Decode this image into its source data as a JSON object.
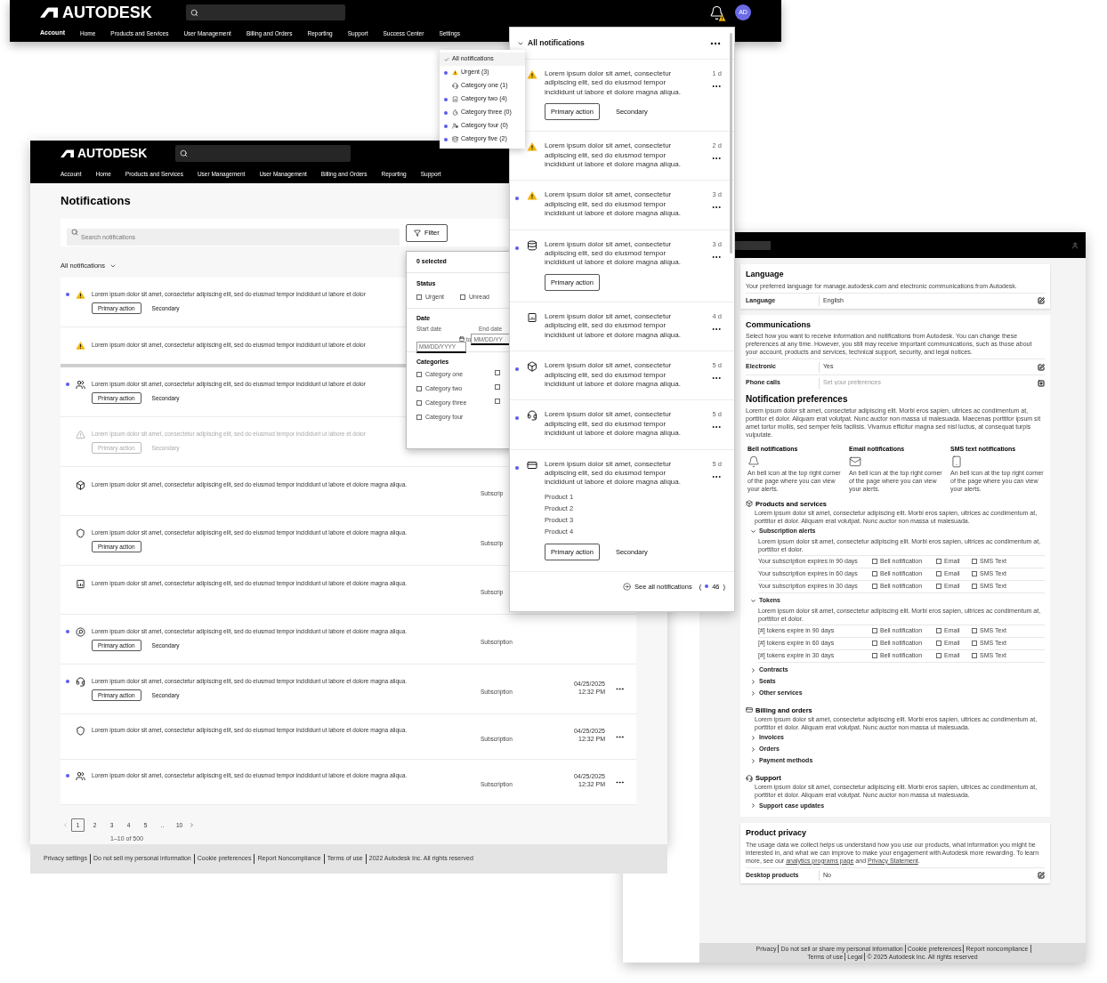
{
  "header_window": {
    "logo": "AUTODESK",
    "nav": [
      {
        "label": "Account",
        "selected": true
      },
      {
        "label": "Home",
        "selected": false
      },
      {
        "label": "Products and Services",
        "selected": false
      },
      {
        "label": "User Management",
        "selected": false
      },
      {
        "label": "Billing and Orders",
        "selected": false
      },
      {
        "label": "Reporting",
        "selected": false
      },
      {
        "label": "Support",
        "selected": false
      },
      {
        "label": "Success Center",
        "selected": false
      },
      {
        "label": "Settings",
        "selected": false
      }
    ],
    "avatar": "AD"
  },
  "filter_menu": {
    "items": [
      {
        "label": "All notifications",
        "kind": "all",
        "selected": true,
        "unread": false
      },
      {
        "label": "Urgent (3)",
        "kind": "warning",
        "selected": false,
        "unread": true
      },
      {
        "label": "Category one (1)",
        "kind": "headset",
        "selected": false,
        "unread": false
      },
      {
        "label": "Category two (4)",
        "kind": "report",
        "selected": false,
        "unread": true
      },
      {
        "label": "Category three (0)",
        "kind": "timer",
        "selected": false,
        "unread": true
      },
      {
        "label": "Category four (0)",
        "kind": "user_gear",
        "selected": false,
        "unread": true
      },
      {
        "label": "Category five (2)",
        "kind": "database",
        "selected": false,
        "unread": true
      }
    ]
  },
  "main_window": {
    "logo": "AUTODESK",
    "nav": [
      "Account",
      "Home",
      "Products and Services",
      "User Management",
      "User Management",
      "Billing and Orders",
      "Reporting",
      "Support"
    ],
    "title": "Notifications",
    "search": {
      "placeholder": "Search notifications"
    },
    "filter_button": "Filter",
    "view_select": "All notifications",
    "rows": [
      {
        "kind": "warning",
        "unread": true,
        "disabled": false,
        "thick_divider": false,
        "text": "Lorem ipsum dolor sit amet, consectetur adipiscing elit, sed do eiusmod tempor incididunt ut labore et dolor",
        "primary_action": "Primary action",
        "secondary_action": "Secondary"
      },
      {
        "kind": "warning",
        "unread": false,
        "disabled": false,
        "thick_divider": true,
        "text": "Lorem ipsum dolor sit amet, consectetur adipiscing elit, sed do eiusmod tempor incididunt ut labore et dolor"
      },
      {
        "kind": "users",
        "unread": true,
        "disabled": false,
        "thick_divider": false,
        "text": "Lorem ipsum dolor sit amet, consectetur adipiscing elit, sed do eiusmod tempor incididunt ut labore et dolor",
        "primary_action": "Primary action",
        "secondary_action": "Secondary"
      },
      {
        "kind": "warning",
        "unread": false,
        "disabled": true,
        "thick_divider": false,
        "text": "Lorem ipsum dolor sit amet, consectetur adipiscing elit, sed do eiusmod tempor incididunt ut labore et dolor",
        "primary_action": "Primary action",
        "secondary_action": "Secondary"
      },
      {
        "kind": "cube",
        "unread": false,
        "disabled": false,
        "thick_divider": false,
        "text": "Lorem ipsum dolor sit amet, consectetur adipiscing elit, sed do eiusmod tempor incididunt ut labore et dolore magna aliqua.",
        "category": "Subscrip"
      },
      {
        "kind": "shield",
        "unread": false,
        "disabled": false,
        "thick_divider": false,
        "text": "Lorem ipsum dolor sit amet, consectetur adipiscing elit, sed do eiusmod tempor incididunt ut labore et dolore magna aliqua.",
        "primary_action": "Primary action",
        "category": "Subscrip"
      },
      {
        "kind": "report",
        "unread": false,
        "disabled": false,
        "thick_divider": false,
        "text": "Lorem ipsum dolor sit amet, consectetur adipiscing elit, sed do eiusmod tempor incididunt ut labore et dolore magna aliqua.",
        "category": "Subscrip"
      },
      {
        "kind": "search",
        "unread": true,
        "disabled": false,
        "thick_divider": false,
        "text": "Lorem ipsum dolor sit amet, consectetur adipiscing elit, sed do eiusmod tempor incididunt ut labore et dolore magna aliqua.",
        "primary_action": "Primary action",
        "secondary_action": "Secondary",
        "category": "Subscription"
      },
      {
        "kind": "headset",
        "unread": true,
        "disabled": false,
        "thick_divider": false,
        "text": "Lorem ipsum dolor sit amet, consectetur adipiscing elit, sed do eiusmod tempor incididunt ut labore et dolore magna aliqua.",
        "primary_action": "Primary action",
        "secondary_action": "Secondary",
        "category": "Subscription",
        "date": "04/25/2025",
        "time": "12:32 PM"
      },
      {
        "kind": "shield",
        "unread": false,
        "disabled": false,
        "thick_divider": false,
        "text": "Lorem ipsum dolor sit amet, consectetur adipiscing elit, sed do eiusmod tempor incididunt ut labore et dolore magna aliqua.",
        "category": "Subscription",
        "date": "04/25/2025",
        "time": "12:32 PM"
      },
      {
        "kind": "users",
        "unread": true,
        "disabled": false,
        "thick_divider": false,
        "text": "Lorem ipsum dolor sit amet, consectetur adipiscing elit, sed do eiusmod tempor incididunt ut labore et dolore magna aliqua.",
        "category": "Subscription",
        "date": "04/25/2025",
        "time": "12:32 PM"
      }
    ],
    "pagination": {
      "pages": [
        {
          "label": "1",
          "selected": true
        },
        {
          "label": "2",
          "selected": false
        },
        {
          "label": "3",
          "selected": false
        },
        {
          "label": "4",
          "selected": false
        },
        {
          "label": "5",
          "selected": false
        },
        {
          "label": "..",
          "selected": false
        },
        {
          "label": "10",
          "selected": false
        }
      ],
      "summary": "1–10 of 500"
    },
    "footer": [
      "Privacy settings",
      "Do not sell my personal information",
      "Cookie preferences",
      "Report Noncompliance",
      "Terms of use",
      "2022 Autodesk Inc. All rights reserved"
    ]
  },
  "filter_popover": {
    "selected_count": "0 selected",
    "status_heading": "Status",
    "status_options": [
      {
        "label": "Urgent",
        "checked": false
      },
      {
        "label": "Unread",
        "checked": false
      }
    ],
    "date_heading": "Date",
    "start_label": "Start date",
    "end_label": "End date",
    "start_placeholder": "MM/DD/YYYY",
    "to": "to",
    "end_placeholder": "MM/DD/YY",
    "categories_heading": "Categories",
    "categories": [
      {
        "label": "Category one",
        "checked": false
      },
      {
        "label": "Category two",
        "checked": false
      },
      {
        "label": "Category three",
        "checked": false
      },
      {
        "label": "Category four",
        "checked": false
      }
    ],
    "categories_col2": [
      {
        "checked": false
      },
      {
        "checked": false
      },
      {
        "checked": false
      }
    ]
  },
  "notification_panel": {
    "title": "All notifications",
    "items": [
      {
        "kind": "warning",
        "unread": false,
        "text": "Lorem ipsum dolor sit amet, consectetur adipiscing elit, sed do eiusmod tempor incididunt ut labore et dolore magna aliqua.",
        "age": "1 d",
        "primary_action": "Primary action",
        "secondary_action": "Secondary"
      },
      {
        "kind": "warning",
        "unread": false,
        "text": "Lorem ipsum dolor sit amet, consectetur adipiscing elit, sed do eiusmod tempor incididunt ut labore et dolore magna aliqua.",
        "age": "2 d"
      },
      {
        "kind": "warning",
        "unread": true,
        "text": "Lorem ipsum dolor sit amet, consectetur adipiscing elit, sed do eiusmod tempor incididunt ut labore et dolore magna aliqua.",
        "age": "3 d"
      },
      {
        "kind": "database",
        "unread": true,
        "text": "Lorem ipsum dolor sit amet, consectetur adipiscing elit, sed do eiusmod tempor incididunt ut labore et dolore magna aliqua.",
        "age": "3 d",
        "primary_action": "Primary action"
      },
      {
        "kind": "report",
        "unread": false,
        "text": "Lorem ipsum dolor sit amet, consectetur adipiscing elit, sed do eiusmod tempor incididunt ut labore et dolore magna aliqua.",
        "age": "4 d"
      },
      {
        "kind": "cube",
        "unread": true,
        "text": "Lorem ipsum dolor sit amet, consectetur adipiscing elit, sed do eiusmod tempor incididunt ut labore et dolore magna aliqua.",
        "age": "5 d"
      },
      {
        "kind": "headset",
        "unread": true,
        "text": "Lorem ipsum dolor sit amet, consectetur adipiscing elit, sed do eiusmod tempor incididunt ut labore et dolore magna aliqua.",
        "age": "5 d"
      },
      {
        "kind": "card",
        "unread": true,
        "text": "Lorem ipsum dolor sit amet, consectetur adipiscing elit, sed do eiusmod tempor incididunt ut labore et dolore magna aliqua.",
        "age": "5 d",
        "products": [
          "Product 1",
          "Product 2",
          "Product 3",
          "Product 4"
        ],
        "primary_action": "Primary action",
        "secondary_action": "Secondary"
      }
    ],
    "see_all": "See all notifications",
    "count_open": "(",
    "count": "46",
    "count_close": ")"
  },
  "settings_window": {
    "language": {
      "title": "Language",
      "description": "Your preferred language for manage.autodesk.com and electronic communications from Autodesk.",
      "rows": [
        {
          "label": "Language",
          "value": "English",
          "kind": "edit"
        }
      ]
    },
    "communications": {
      "title": "Communications",
      "description": "Select how you want to receive information and notifications from Autodesk. You can change these preferences at any time. However, you still may receive important communications, such as those about your account, products and services, technical support, security, and legal notices.",
      "rows": [
        {
          "label": "Electronic",
          "value": "Yes",
          "kind": "edit"
        },
        {
          "label": "Phone calls",
          "placeholder": "Set your preferences",
          "kind": "add"
        }
      ]
    },
    "notification_preferences": {
      "title": "Notification preferences",
      "description": "Lorem ipsum dolor sit amet, consectetur adipiscing elit. Morbi eros sapien, ultrices ac condimentum at, porttitor et dolor. Aliquam erat volutpat. Nunc auctor non massa ut malesuada. Maecenas porttitor ipsum sit amet tortor mollis, sed semper felis facilisis. Vivamus efficitur magna sed nisl luctus, at consequat turpis vulputate.",
      "channels": [
        {
          "kind": "bell",
          "title": "Bell notifications",
          "description": "An bell icon at the top right corner of the page where you can view your alerts."
        },
        {
          "kind": "mail",
          "title": "Email notifications",
          "description": "An bell icon at the top right corner of the page where you can view your alerts."
        },
        {
          "kind": "phone",
          "title": "SMS text notifications",
          "description": "An bell icon at the top right corner of the page where you can view your alerts."
        }
      ],
      "sections": [
        {
          "kind": "cube",
          "title": "Products and services",
          "description": "Lorem ipsum dolor sit amet, consectetur adipiscing elit. Morbi eros sapien, ultrices ac condimentum at, porttitor et dolor. Aliquam erat volutpat. Nunc auctor non massa ut malesuada.",
          "groups": [
            {
              "title": "Subscription alerts",
              "expanded": true,
              "description": "Lorem ipsum dolor sit amet, consectetur adipiscing elit. Morbi eros sapien, ultrices ac condimentum at, porttitor et dolor.",
              "rows": [
                {
                  "label": "Your subscription expires in 90 days",
                  "options": [
                    {
                      "label": "Bell notification",
                      "checked": false
                    },
                    {
                      "label": "Email",
                      "checked": false
                    },
                    {
                      "label": "SMS Text",
                      "checked": false
                    }
                  ]
                },
                {
                  "label": "Your subscription expires in 60 days",
                  "options": [
                    {
                      "label": "Bell notification",
                      "checked": false
                    },
                    {
                      "label": "Email",
                      "checked": false
                    },
                    {
                      "label": "SMS Text",
                      "checked": false
                    }
                  ]
                },
                {
                  "label": "Your subscription expires in 30 days",
                  "options": [
                    {
                      "label": "Bell notification",
                      "checked": false
                    },
                    {
                      "label": "Email",
                      "checked": false
                    },
                    {
                      "label": "SMS Text",
                      "checked": false
                    }
                  ]
                }
              ]
            },
            {
              "title": "Tokens",
              "expanded": true,
              "description": "Lorem ipsum dolor sit amet, consectetur adipiscing elit. Morbi eros sapien, ultrices ac condimentum at, porttitor et dolor.",
              "rows": [
                {
                  "label": "[#] tokens expire in 90 days",
                  "options": [
                    {
                      "label": "Bell notification",
                      "checked": false
                    },
                    {
                      "label": "Email",
                      "checked": false
                    },
                    {
                      "label": "SMS Text",
                      "checked": false
                    }
                  ]
                },
                {
                  "label": "[#] tokens expire in 60 days",
                  "options": [
                    {
                      "label": "Bell notification",
                      "checked": false
                    },
                    {
                      "label": "Email",
                      "checked": false
                    },
                    {
                      "label": "SMS Text",
                      "checked": false
                    }
                  ]
                },
                {
                  "label": "[#] tokens expire in 30 days",
                  "options": [
                    {
                      "label": "Bell notification",
                      "checked": false
                    },
                    {
                      "label": "Email",
                      "checked": false
                    },
                    {
                      "label": "SMS Text",
                      "checked": false
                    }
                  ]
                }
              ]
            },
            {
              "title": "Contracts",
              "expanded": false
            },
            {
              "title": "Seats",
              "expanded": false
            },
            {
              "title": "Other services",
              "expanded": false
            }
          ]
        },
        {
          "kind": "card",
          "title": "Billing and orders",
          "description": "Lorem ipsum dolor sit amet, consectetur adipiscing elit. Morbi eros sapien, ultrices ac condimentum at, porttitor et dolor. Aliquam erat volutpat. Nunc auctor non massa ut malesuada.",
          "groups": [
            {
              "title": "Invoices",
              "expanded": false
            },
            {
              "title": "Orders",
              "expanded": false
            },
            {
              "title": "Payment methods",
              "expanded": false
            }
          ]
        },
        {
          "kind": "headset",
          "title": "Support",
          "description": "Lorem ipsum dolor sit amet, consectetur adipiscing elit. Morbi eros sapien, ultrices ac condimentum at, porttitor et dolor. Aliquam erat volutpat. Nunc auctor non massa ut malesuada.",
          "groups": [
            {
              "title": "Support case updates",
              "expanded": false
            }
          ]
        }
      ]
    },
    "product_privacy": {
      "title": "Product privacy",
      "description_parts": [
        {
          "text": "The usage data we collect helps us understand how you use our products, what information you might be interested in, and what we can improve to make your engagement with Autodesk more rewarding. To learn more, see our ",
          "link": false
        },
        {
          "text": "analytics programs page",
          "link": true
        },
        {
          "text": " and ",
          "link": false
        },
        {
          "text": "Privacy Statement",
          "link": true
        },
        {
          "text": ".",
          "link": false
        }
      ],
      "rows": [
        {
          "label": "Desktop products",
          "value": "No",
          "kind": "edit"
        }
      ]
    },
    "footer": [
      "Privacy",
      "Do not sell or share my personal information",
      "Cookie preferences",
      "Report noncompliance",
      "Terms of use",
      "Legal",
      "© 2025 Autodesk Inc. All rights reserved"
    ]
  }
}
